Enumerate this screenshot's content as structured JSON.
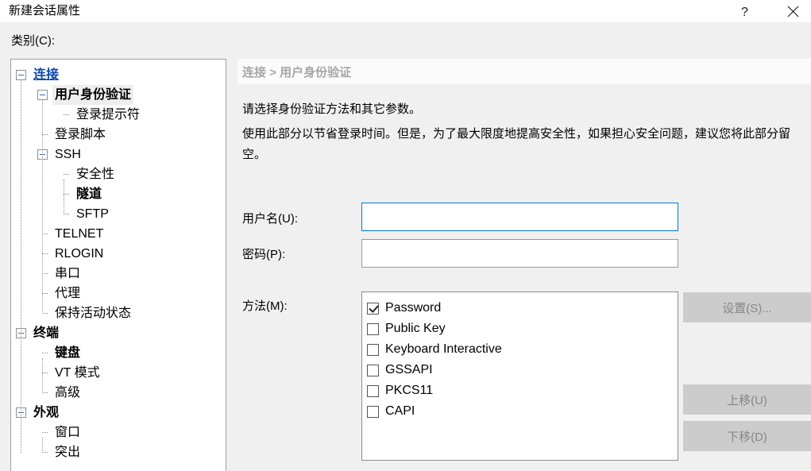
{
  "window": {
    "title": "新建会话属性",
    "help_label": "?",
    "close_label": "✕"
  },
  "category": {
    "label": "类别(C):",
    "tree": [
      {
        "level": 0,
        "label": "连接",
        "toggle": "minus",
        "style": "link"
      },
      {
        "level": 1,
        "label": "用户身份验证",
        "toggle": "minus",
        "style": "bold-selected"
      },
      {
        "level": 2,
        "label": "登录提示符",
        "toggle": "none",
        "style": "normal"
      },
      {
        "level": 1,
        "label": "登录脚本",
        "toggle": "none",
        "style": "normal"
      },
      {
        "level": 1,
        "label": "SSH",
        "toggle": "minus",
        "style": "normal"
      },
      {
        "level": 2,
        "label": "安全性",
        "toggle": "none",
        "style": "normal"
      },
      {
        "level": 2,
        "label": "隧道",
        "toggle": "none",
        "style": "bold"
      },
      {
        "level": 2,
        "label": "SFTP",
        "toggle": "none",
        "style": "normal"
      },
      {
        "level": 1,
        "label": "TELNET",
        "toggle": "none",
        "style": "normal"
      },
      {
        "level": 1,
        "label": "RLOGIN",
        "toggle": "none",
        "style": "normal"
      },
      {
        "level": 1,
        "label": "串口",
        "toggle": "none",
        "style": "normal"
      },
      {
        "level": 1,
        "label": "代理",
        "toggle": "none",
        "style": "normal"
      },
      {
        "level": 1,
        "label": "保持活动状态",
        "toggle": "none",
        "style": "normal"
      },
      {
        "level": 0,
        "label": "终端",
        "toggle": "minus",
        "style": "bold"
      },
      {
        "level": 1,
        "label": "键盘",
        "toggle": "none",
        "style": "bold"
      },
      {
        "level": 1,
        "label": "VT 模式",
        "toggle": "none",
        "style": "normal"
      },
      {
        "level": 1,
        "label": "高级",
        "toggle": "none",
        "style": "normal"
      },
      {
        "level": 0,
        "label": "外观",
        "toggle": "minus",
        "style": "bold"
      },
      {
        "level": 1,
        "label": "窗口",
        "toggle": "none",
        "style": "normal"
      },
      {
        "level": 1,
        "label": "突出",
        "toggle": "none",
        "style": "normal"
      }
    ]
  },
  "page": {
    "breadcrumb": "连接 > 用户身份验证",
    "description_line1": "请选择身份验证方法和其它参数。",
    "description_line2": "使用此部分以节省登录时间。但是，为了最大限度地提高安全性，如果担心安全问题，建议您将此部分留空。",
    "username": {
      "label": "用户名(U):",
      "value": "",
      "placeholder": ""
    },
    "password": {
      "label": "密码(P):",
      "value": "",
      "placeholder": ""
    },
    "methods": {
      "label": "方法(M):",
      "items": [
        {
          "label": "Password",
          "checked": true
        },
        {
          "label": "Public Key",
          "checked": false
        },
        {
          "label": "Keyboard Interactive",
          "checked": false
        },
        {
          "label": "GSSAPI",
          "checked": false
        },
        {
          "label": "PKCS11",
          "checked": false
        },
        {
          "label": "CAPI",
          "checked": false
        }
      ]
    },
    "buttons": {
      "settings": "设置(S)...",
      "move_up": "上移(U)",
      "move_down": "下移(D)"
    }
  },
  "colors": {
    "dialog_bg": "#f0f0f0",
    "panel_bg": "#ffffff",
    "accent_focus": "#0078d7",
    "link": "#0a47a9",
    "button_disabled_bg": "#cccccc",
    "button_disabled_text": "#868686",
    "breadcrumb_text": "#a6a6a6"
  }
}
